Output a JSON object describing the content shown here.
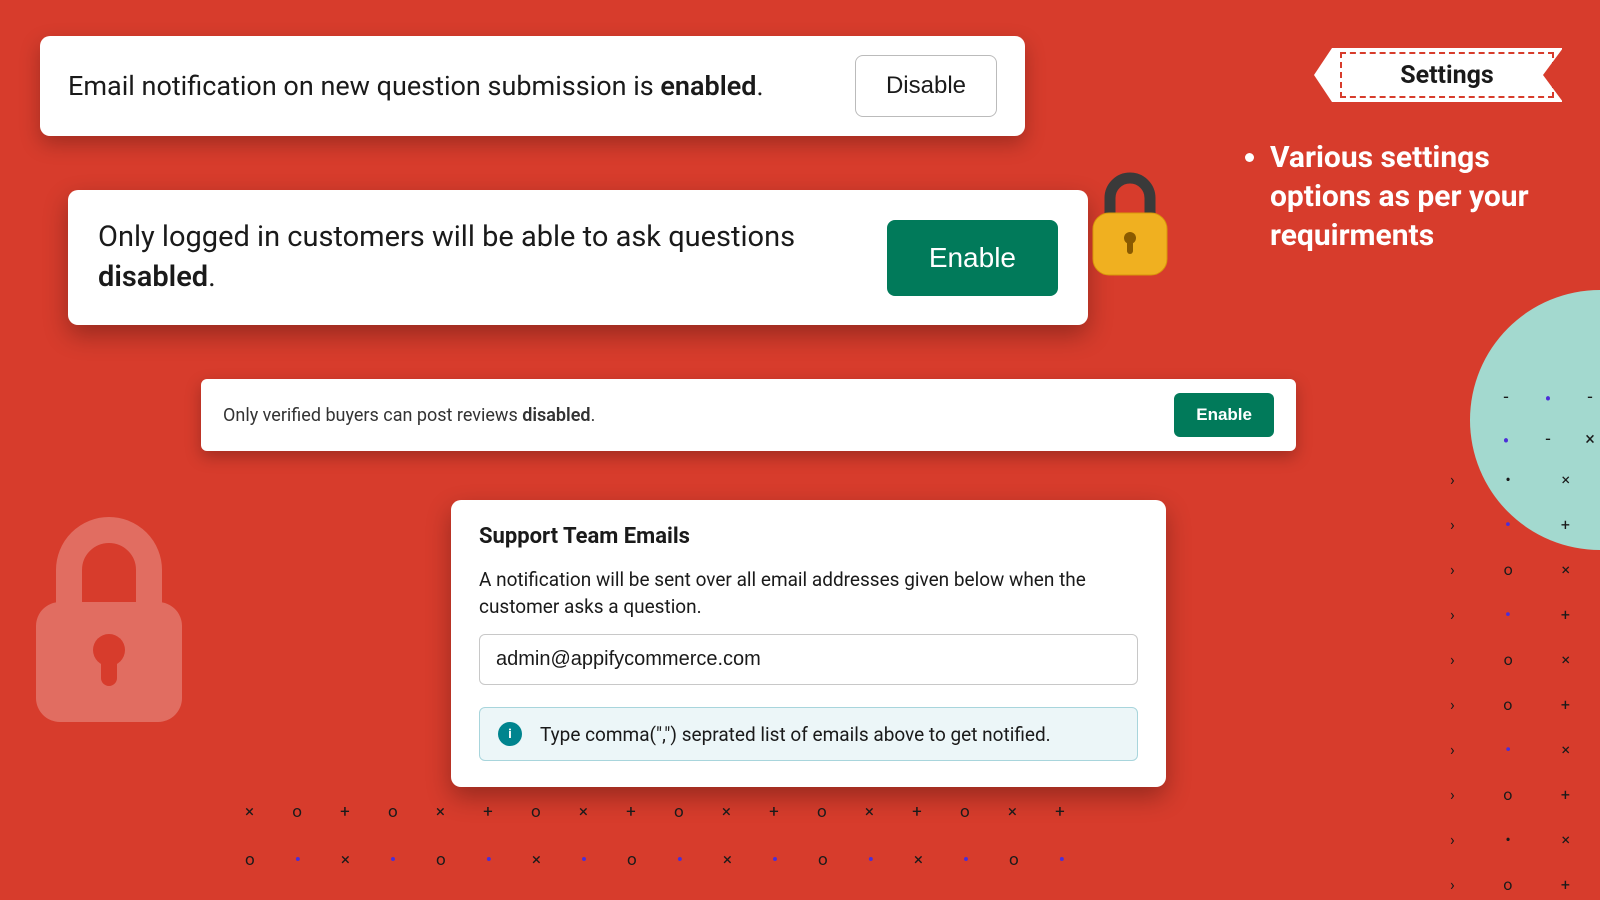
{
  "card1": {
    "text_prefix": "Email notification on new question submission is ",
    "status": "enabled",
    "text_suffix": ".",
    "button": "Disable"
  },
  "card2": {
    "text_prefix": "Only logged in customers will be able to ask questions ",
    "status": "disabled",
    "text_suffix": ".",
    "button": "Enable"
  },
  "card3": {
    "text_prefix": "Only verified buyers can post reviews ",
    "status": "disabled",
    "text_suffix": ".",
    "button": "Enable"
  },
  "card4": {
    "title": "Support Team Emails",
    "description": "A notification will be sent over all email addresses given below when the customer asks a question.",
    "email_value": "admin@appifycommerce.com",
    "info_text": "Type comma(\",\") seprated list of emails above to get notified."
  },
  "ribbon": {
    "label": "Settings"
  },
  "bullet": {
    "text": "Various settings options as per your requirments"
  }
}
